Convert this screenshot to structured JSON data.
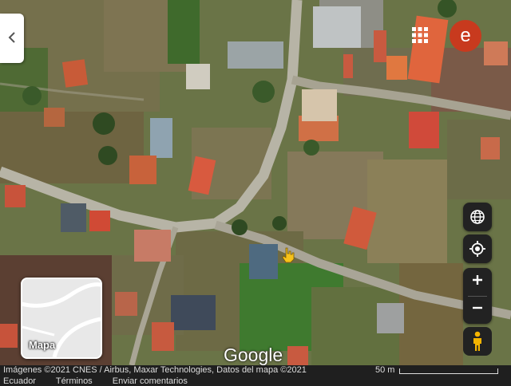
{
  "controls": {
    "side_panel_icon": "chevron-left-icon",
    "apps_icon": "grid-apps-icon",
    "avatar_letter": "e",
    "avatar_color": "#c83a1e",
    "layers_icon": "globe-icon",
    "location_icon": "my-location-icon",
    "zoom_in": "+",
    "zoom_out": "−",
    "street_view_icon": "pegman-icon"
  },
  "minimap": {
    "label": "Mapa"
  },
  "logo": "Google",
  "cursor_icon": "hand-pointer-icon",
  "footer": {
    "attribution": "Imágenes ©2021 CNES / Airbus, Maxar Technologies, Datos del mapa ©2021",
    "scale": "50 m",
    "country": "Ecuador",
    "terms": "Términos",
    "feedback": "Enviar comentarios"
  }
}
